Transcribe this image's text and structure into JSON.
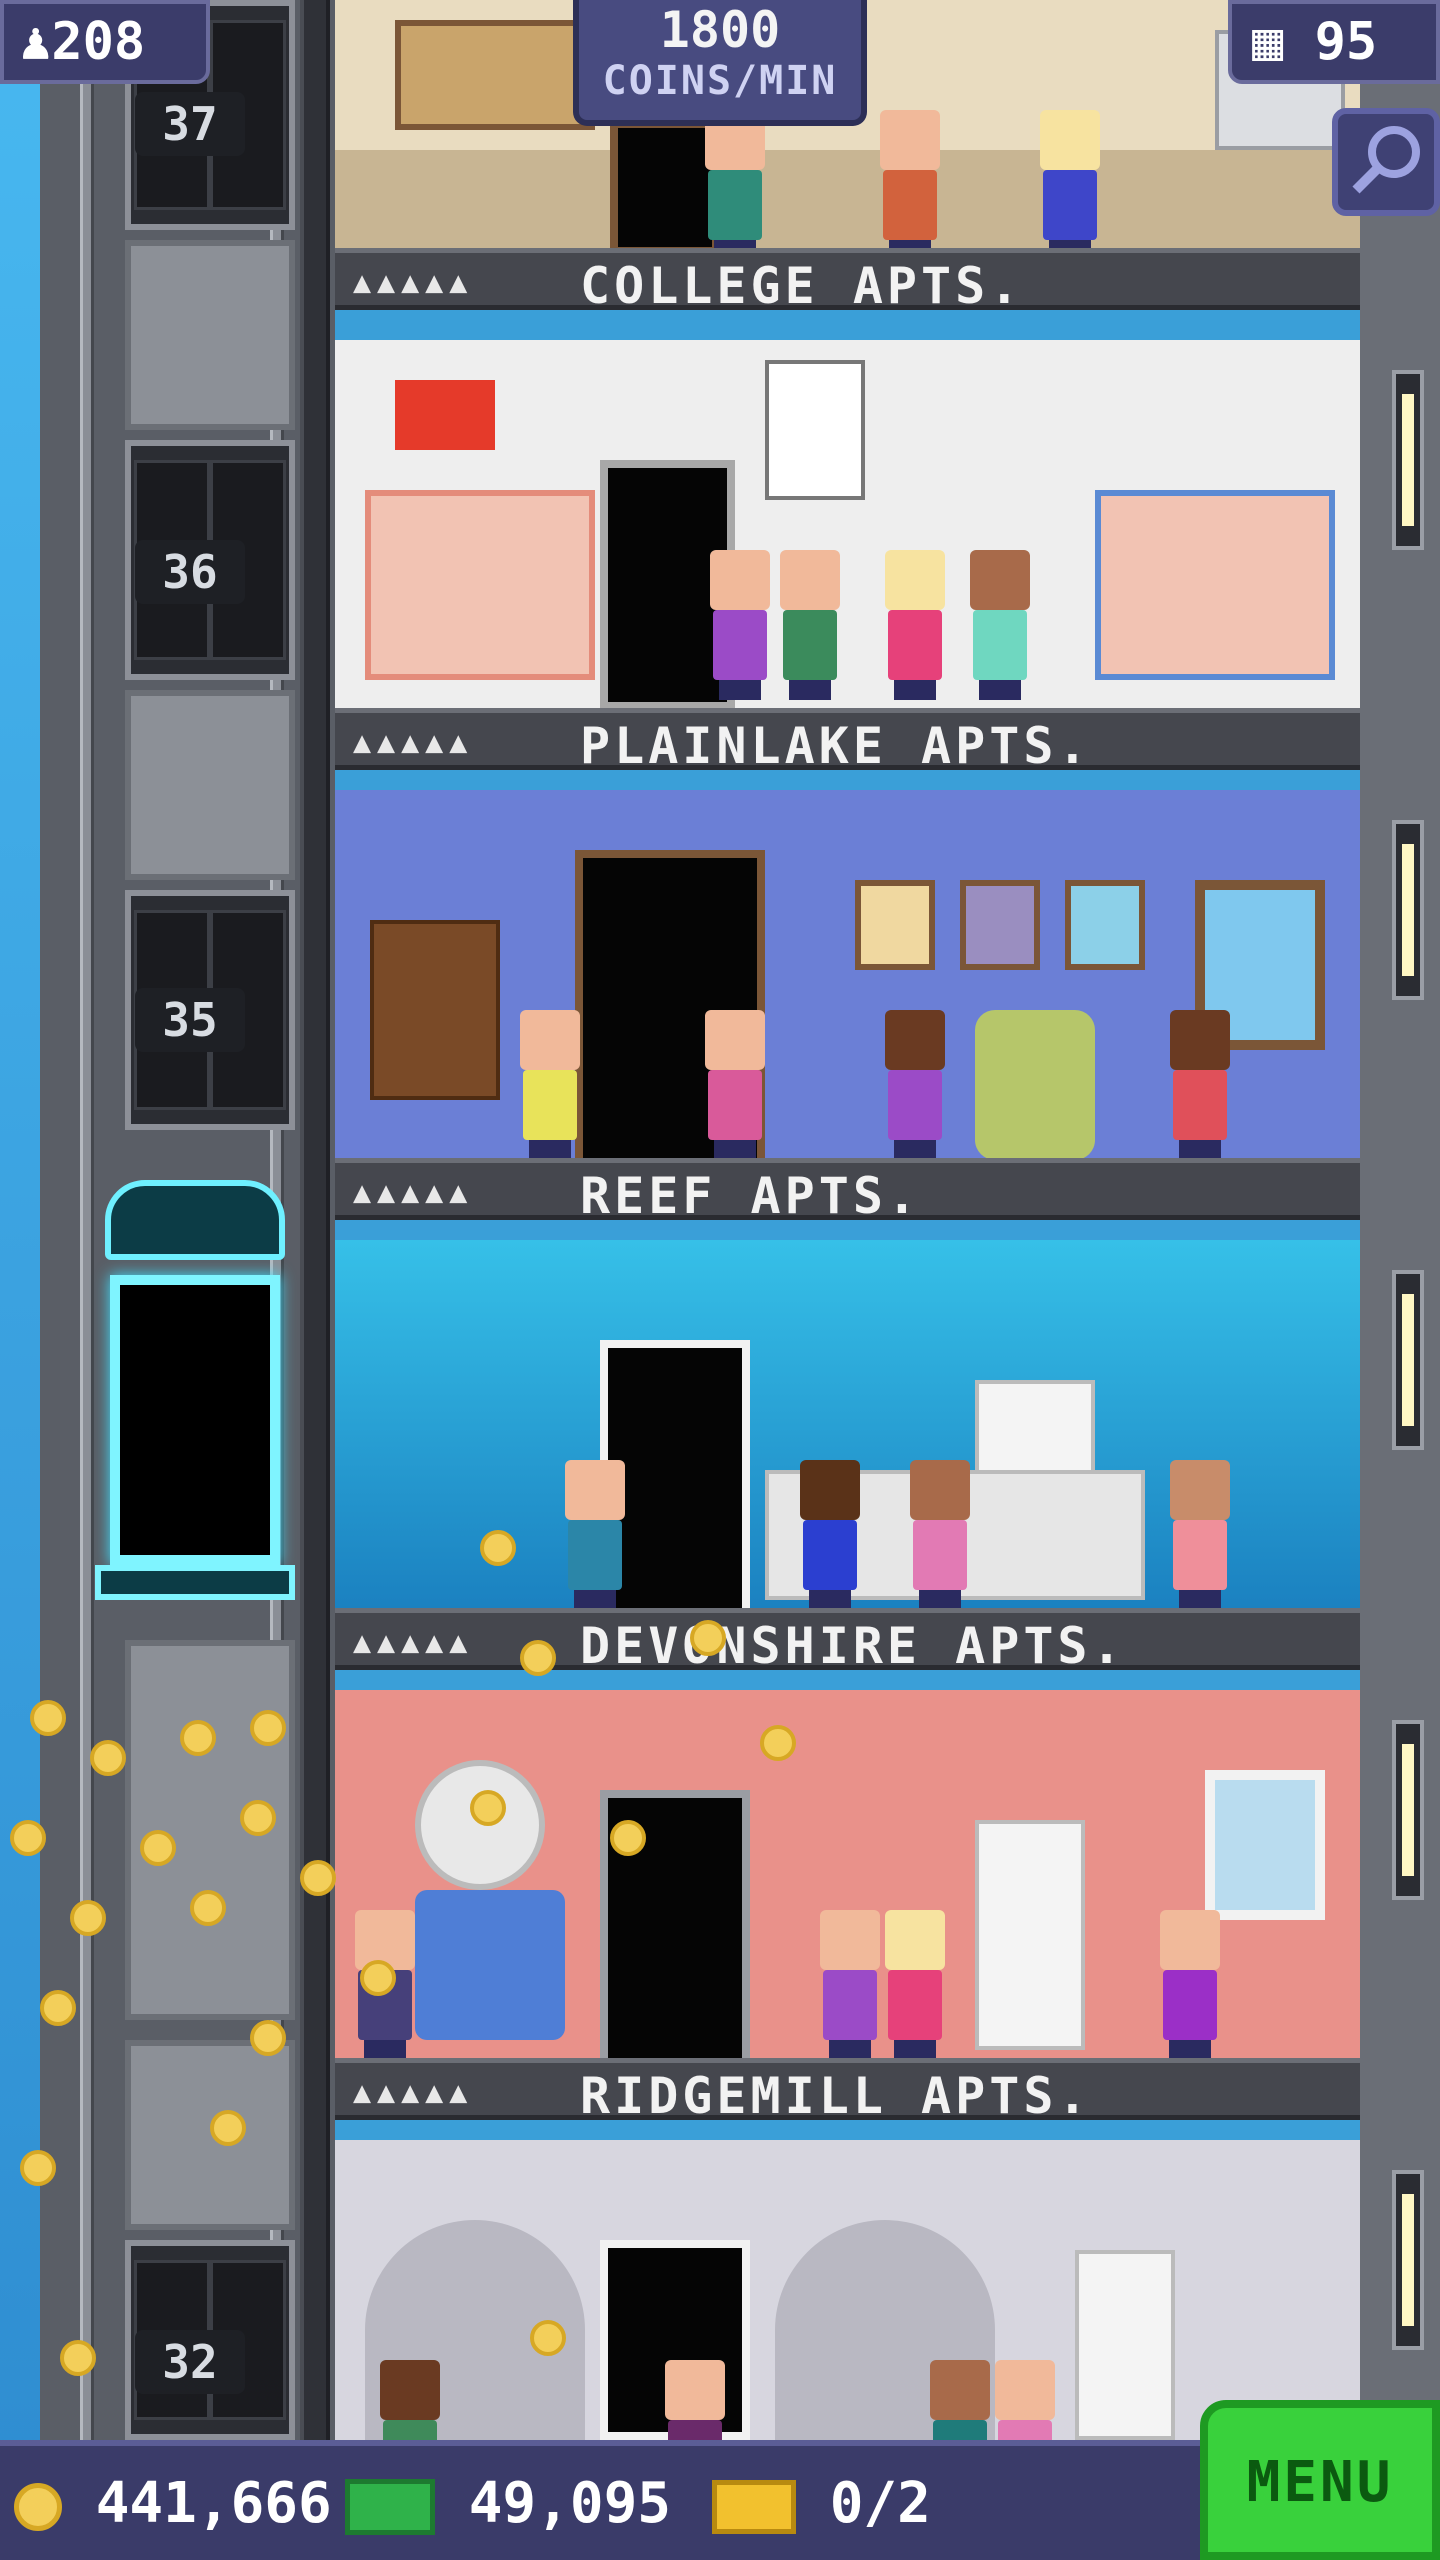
{
  "hud": {
    "population": "208",
    "coins_rate_value": "1800",
    "coins_rate_unit": "COINS/MIN",
    "floors_count": "95"
  },
  "elevator": {
    "floor_numbers": [
      "37",
      "36",
      "35",
      "32"
    ]
  },
  "floors": [
    {
      "name": "COLLEGE APTS.",
      "occupancy": "▲▲▲▲▲"
    },
    {
      "name": "PLAINLAKE APTS.",
      "occupancy": "▲▲▲▲▲"
    },
    {
      "name": "REEF APTS.",
      "occupancy": "▲▲▲▲▲"
    },
    {
      "name": "DEVONSHIRE APTS.",
      "occupancy": "▲▲▲▲▲"
    },
    {
      "name": "RIDGEMILL APTS.",
      "occupancy": "▲▲▲▲▲"
    }
  ],
  "bottom": {
    "coins": "441,666",
    "bux": "49,095",
    "tickets": "0/2",
    "menu_label": "MENU"
  },
  "colors": {
    "hud_bg": "#3b3c6a",
    "menu_green": "#39d13c",
    "coin_gold": "#f3cf5a"
  }
}
